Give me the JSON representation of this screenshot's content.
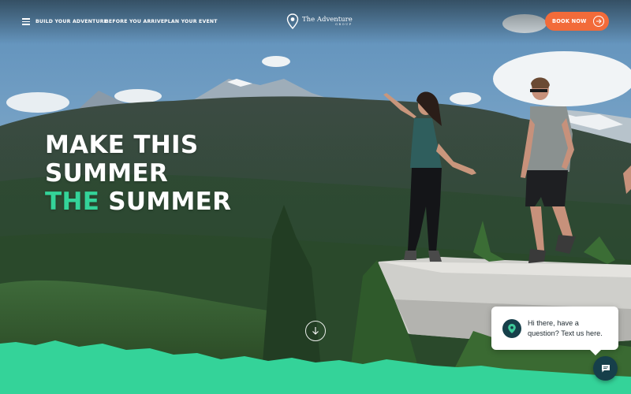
{
  "nav": {
    "menu_icon": "hamburger-menu-icon",
    "links": [
      "BUILD YOUR ADVENTURE",
      "BEFORE YOU ARRIVE",
      "PLAN YOUR EVENT"
    ],
    "logo": {
      "line1": "The Adventure",
      "line2": "GROUP",
      "icon": "map-pin-icon"
    },
    "book_button": {
      "label": "BOOK NOW",
      "icon": "arrow-right-circle-icon"
    }
  },
  "hero": {
    "headline": {
      "line1": "MAKE THIS",
      "line2": "SUMMER",
      "line3_accent": "THE",
      "line3_rest": " SUMMER"
    },
    "scroll_icon": "arrow-down-circle-icon"
  },
  "chat": {
    "message": "Hi there, have a question? Text us here.",
    "avatar_icon": "chat-pin-icon",
    "button_icon": "chat-icon"
  },
  "colors": {
    "accent": "#34d399",
    "book_button": "#f26b3a",
    "chat_dark": "#163f4a",
    "wave_mint": "#34d399"
  }
}
